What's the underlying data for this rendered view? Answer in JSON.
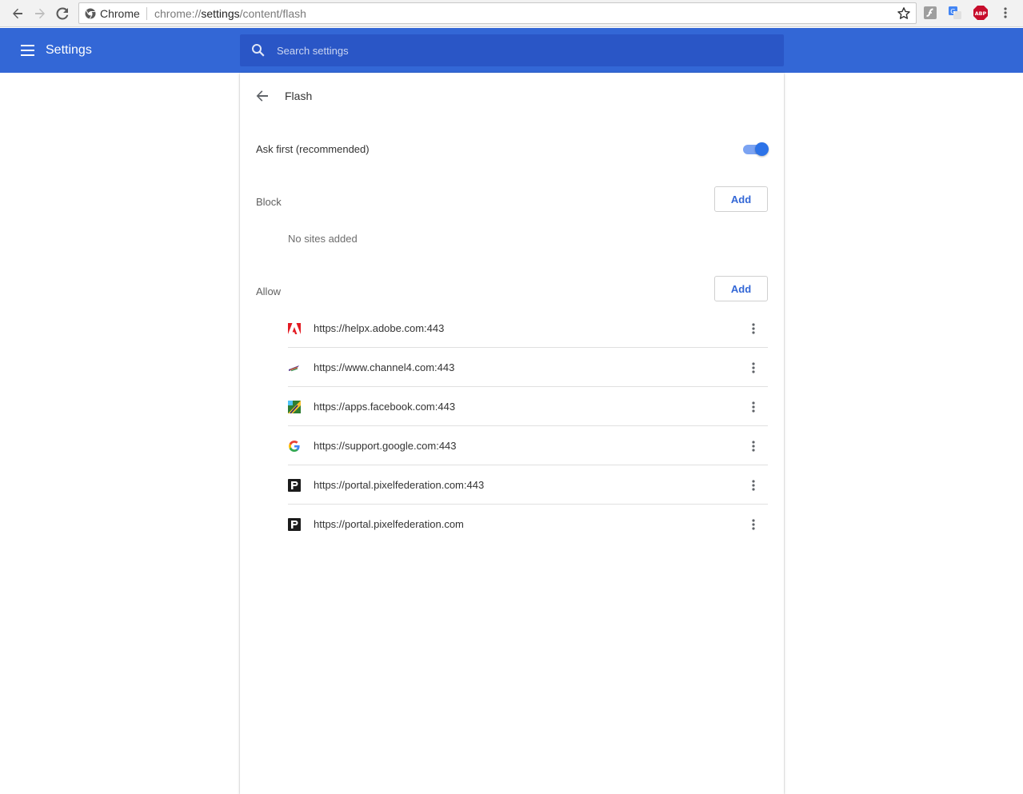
{
  "browser": {
    "chip_label": "Chrome",
    "url_scheme": "chrome://",
    "url_host": "settings",
    "url_path": "/content/flash",
    "extensions": [
      "flash-ext-icon",
      "google-translate-icon",
      "adblock-plus-icon",
      "chrome-menu-icon"
    ],
    "abp_label": "ABP"
  },
  "header": {
    "title": "Settings",
    "search_placeholder": "Search settings",
    "color": "#3367d6"
  },
  "subpage": {
    "title": "Flash",
    "ask_first_label": "Ask first (recommended)",
    "ask_first_enabled": true,
    "block": {
      "label": "Block",
      "add_label": "Add",
      "empty_text": "No sites added"
    },
    "allow": {
      "label": "Allow",
      "add_label": "Add",
      "sites": [
        {
          "url": "https://helpx.adobe.com:443",
          "icon": "adobe-icon"
        },
        {
          "url": "https://www.channel4.com:443",
          "icon": "channel4-icon"
        },
        {
          "url": "https://apps.facebook.com:443",
          "icon": "facebook-app-icon"
        },
        {
          "url": "https://support.google.com:443",
          "icon": "google-icon"
        },
        {
          "url": "https://portal.pixelfederation.com:443",
          "icon": "pixelfederation-icon"
        },
        {
          "url": "https://portal.pixelfederation.com",
          "icon": "pixelfederation-icon"
        }
      ]
    }
  }
}
